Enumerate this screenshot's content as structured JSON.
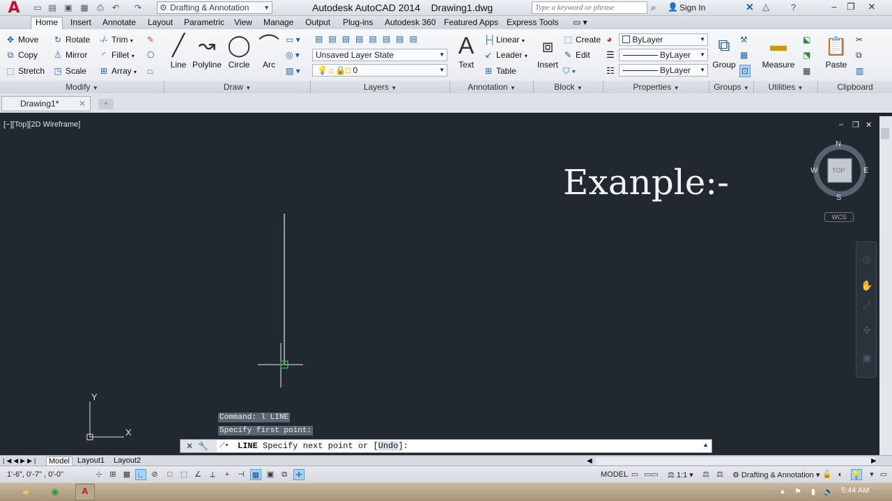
{
  "titlebar": {
    "app_title": "Autodesk AutoCAD 2014    Drawing1.dwg",
    "workspace": "Drafting & Annotation",
    "search_placeholder": "Type a keyword or phrase",
    "sign_in": "Sign In",
    "logo": "A"
  },
  "tabs": [
    "Home",
    "Insert",
    "Annotate",
    "Layout",
    "Parametric",
    "View",
    "Manage",
    "Output",
    "Plug-ins",
    "Autodesk 360",
    "Featured Apps",
    "Express Tools"
  ],
  "ribbon": {
    "modify": {
      "title": "Modify",
      "move": "Move",
      "rotate": "Rotate",
      "trim": "Trim",
      "copy": "Copy",
      "mirror": "Mirror",
      "fillet": "Fillet",
      "stretch": "Stretch",
      "scale": "Scale",
      "array": "Array"
    },
    "draw": {
      "title": "Draw",
      "line": "Line",
      "polyline": "Polyline",
      "circle": "Circle",
      "arc": "Arc"
    },
    "layers": {
      "title": "Layers",
      "layer_state": "Unsaved Layer State",
      "current_layer": "0"
    },
    "annotation": {
      "title": "Annotation",
      "text": "Text",
      "linear": "Linear",
      "leader": "Leader",
      "table": "Table"
    },
    "block": {
      "title": "Block",
      "insert": "Insert",
      "create": "Create",
      "edit": "Edit"
    },
    "properties": {
      "title": "Properties",
      "color": "ByLayer",
      "linetype": "ByLayer",
      "lineweight": "ByLayer"
    },
    "groups": {
      "title": "Groups",
      "group": "Group"
    },
    "utilities": {
      "title": "Utilities",
      "measure": "Measure"
    },
    "clipboard": {
      "title": "Clipboard",
      "paste": "Paste"
    }
  },
  "doc_tab": "Drawing1*",
  "viewport": {
    "label": "[−][Top][2D Wireframe]",
    "canvas_text": "Exanple:-",
    "viewcube": {
      "n": "N",
      "s": "S",
      "e": "E",
      "w": "W",
      "face": "TOP"
    },
    "wcs": "WCS",
    "ucs_x": "X",
    "ucs_y": "Y"
  },
  "command": {
    "history": [
      "Command: l LINE",
      "Specify first point:"
    ],
    "prompt_prefix": "LINE",
    "prompt_text": "Specify next point or [",
    "prompt_option": "Undo",
    "prompt_end": "]:"
  },
  "layout_tabs": [
    "Model",
    "Layout1",
    "Layout2"
  ],
  "status": {
    "coords": "1'-6\", 0'-7\" , 0'-0\"",
    "model": "MODEL",
    "scale": "1:1",
    "workspace": "Drafting & Annotation"
  },
  "taskbar": {
    "clock": "5:44 AM"
  }
}
